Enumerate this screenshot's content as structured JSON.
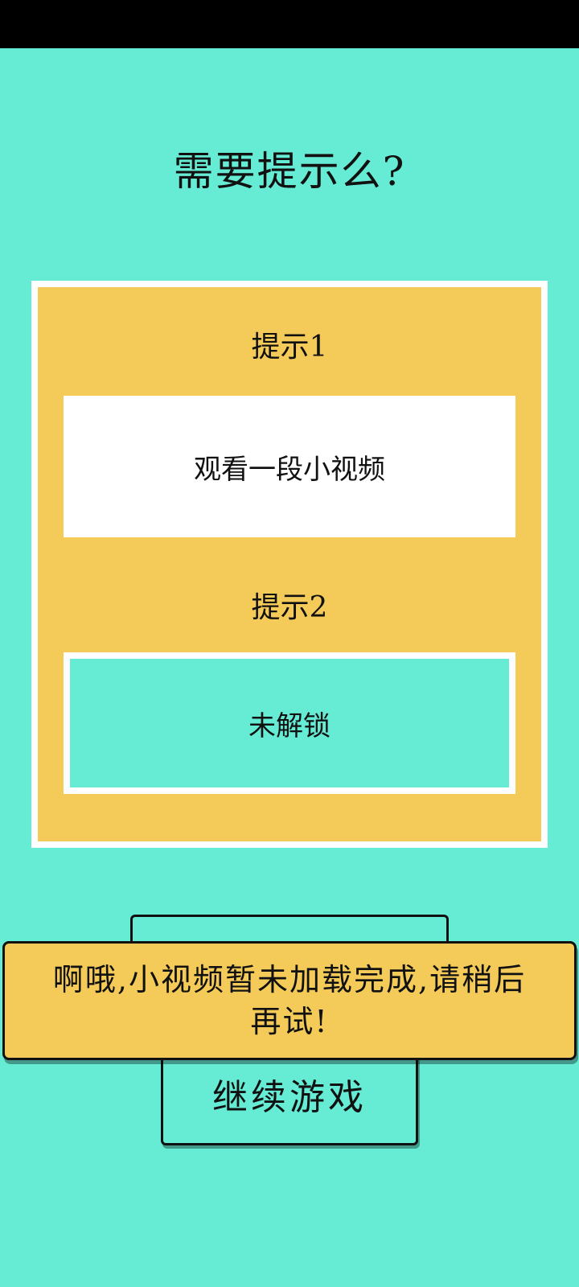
{
  "title": "需要提示么?",
  "hints": {
    "hint1": {
      "label": "提示1",
      "action": "观看一段小视频"
    },
    "hint2": {
      "label": "提示2",
      "status": "未解锁"
    }
  },
  "toast": {
    "message": "啊哦,小视频暂未加载完成,请稍后再试!"
  },
  "continue_button": {
    "label": "继续游戏"
  },
  "colors": {
    "background": "#66ECD4",
    "panel": "#F4CA59",
    "panel_border": "#FFFFFF",
    "text": "#111111"
  }
}
